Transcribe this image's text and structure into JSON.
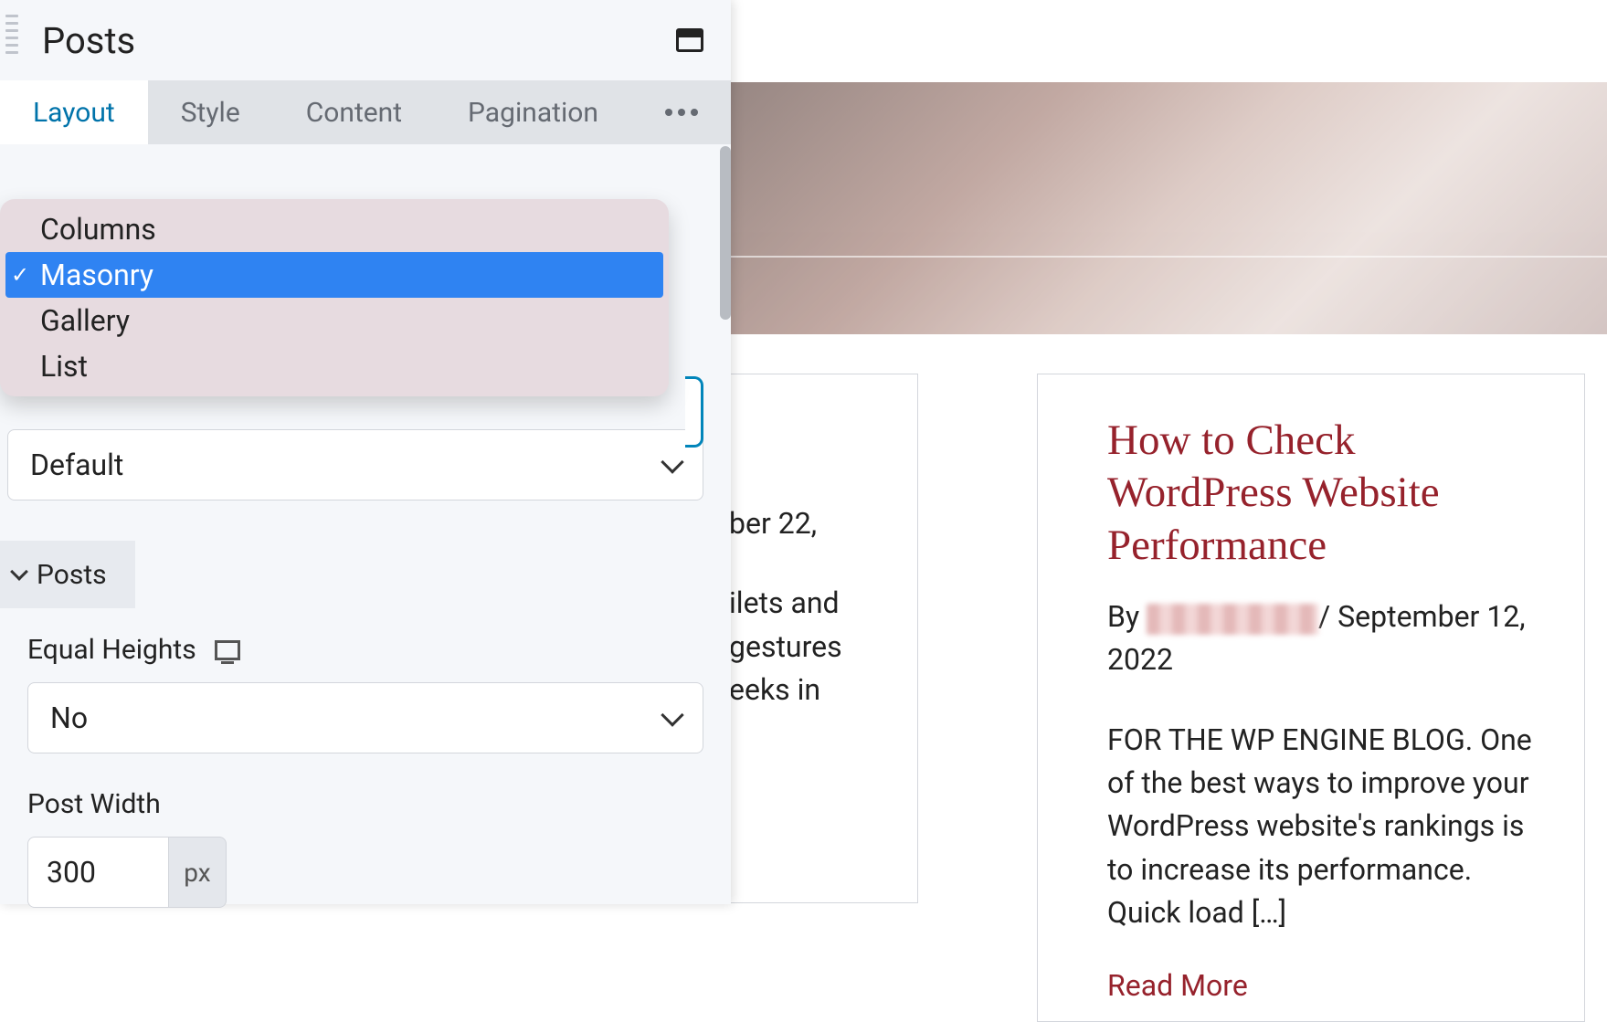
{
  "panel": {
    "title": "Posts",
    "tabs": {
      "layout": "Layout",
      "style": "Style",
      "content": "Content",
      "pagination": "Pagination"
    },
    "active_tab": "Layout",
    "layout_dropdown": {
      "options": [
        "Columns",
        "Masonry",
        "Gallery",
        "List"
      ],
      "selected": "Masonry"
    },
    "second_select_value": "Default",
    "posts_section": {
      "title": "Posts",
      "equal_heights_label": "Equal Heights",
      "equal_heights_value": "No",
      "post_width_label": "Post Width",
      "post_width_value": "300",
      "post_width_unit": "px"
    }
  },
  "preview": {
    "left_card": {
      "date_fragment": "ber 22,",
      "body_lines": [
        "ilets and",
        "gestures",
        "eeks in"
      ]
    },
    "right_card": {
      "title": "How to Check WordPress Website Performance",
      "by_label": "By",
      "sep": "/",
      "date": "September 12, 2022",
      "body": "FOR THE WP ENGINE BLOG. One of the best ways to improve your WordPress website's rankings is to increase its performance. Quick load […]",
      "read_more": "Read More"
    }
  },
  "colors": {
    "accent_link": "#96222c",
    "tab_active": "#0073aa",
    "dropdown_selected": "#2f83f2"
  }
}
